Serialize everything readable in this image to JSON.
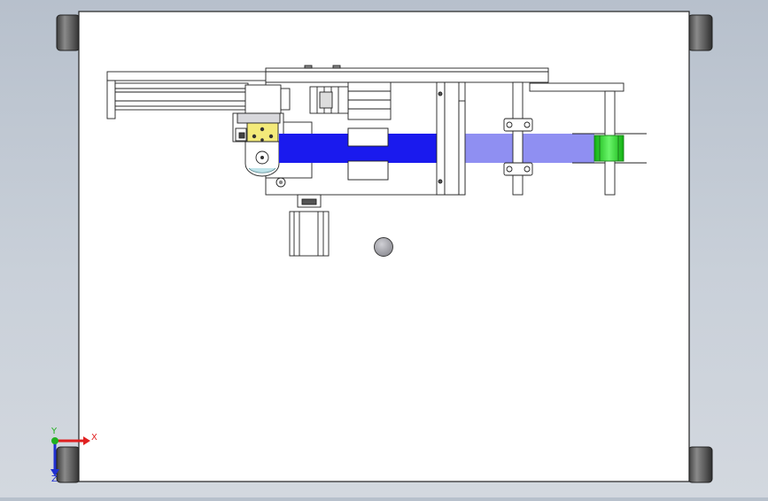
{
  "viewport": {
    "background_top": "#b7c0cc",
    "background_bottom": "#d3d8df"
  },
  "colors": {
    "plate": "#ffffff",
    "outline": "#222222",
    "foot": "#5a5a5a",
    "blue_belt": "#1a1aee",
    "light_belt": "#8f8ff2",
    "green_pulley": "#2ee22e",
    "yellow_block": "#f3ea7a",
    "grey_knob": "#a9a9ae",
    "cyan_roller": "#bfe4ea"
  },
  "triad": {
    "x_label": "X",
    "y_label": "Y",
    "z_label": "Z",
    "x_color": "#e02020",
    "y_color": "#20b020",
    "z_color": "#2030d0"
  }
}
